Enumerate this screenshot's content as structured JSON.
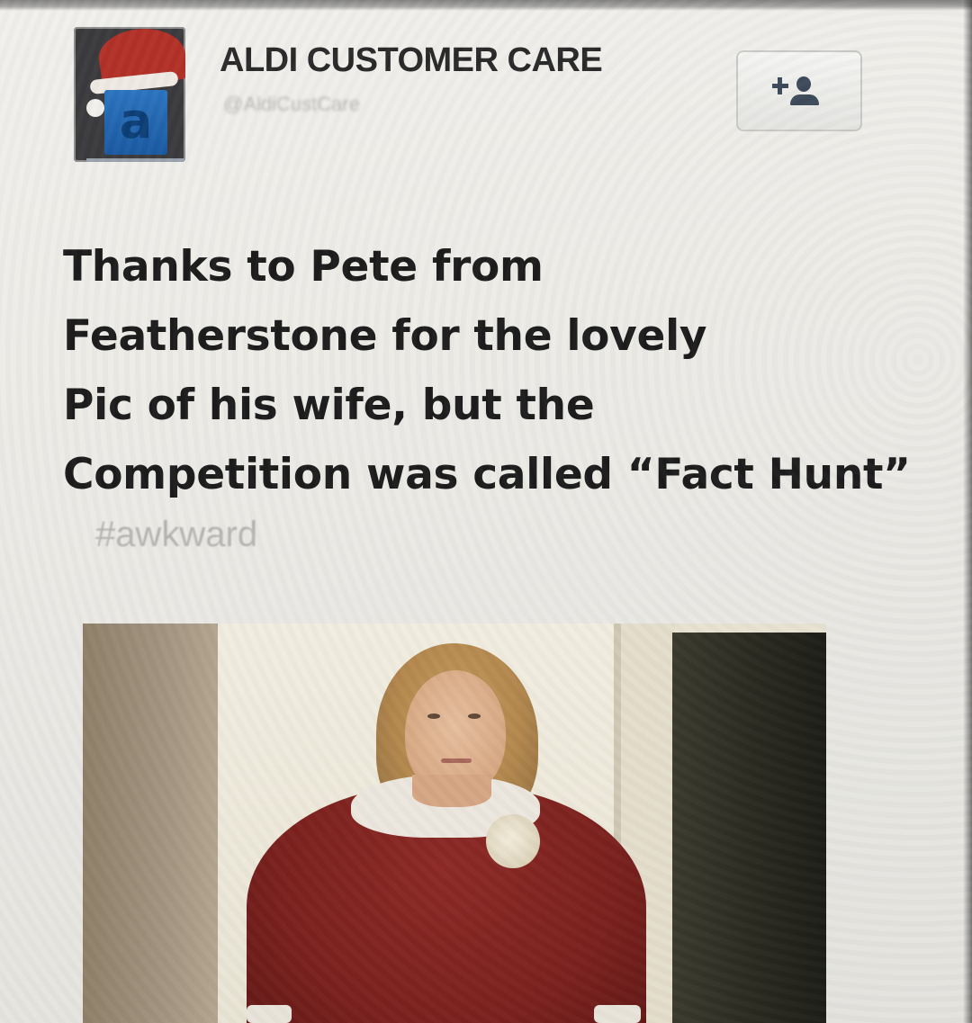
{
  "account": {
    "name": "ALDI CUSTOMER CARE",
    "handle": "@AldiCustCare",
    "avatar_icon": "aldi-logo-santa-hat"
  },
  "follow_button": {
    "icon": "follow-user-icon"
  },
  "tweet": {
    "lines": [
      "Thanks to Pete from",
      "Featherstone for the lovely",
      "Pic of his wife, but the",
      "Competition was called “Fact Hunt”"
    ],
    "hashtag": "#awkward"
  },
  "colors": {
    "text": "#1d1d1d",
    "hashtag": "#b4b4b2",
    "aldi_blue": "#1b5aa1",
    "hat_red": "#b23128"
  }
}
